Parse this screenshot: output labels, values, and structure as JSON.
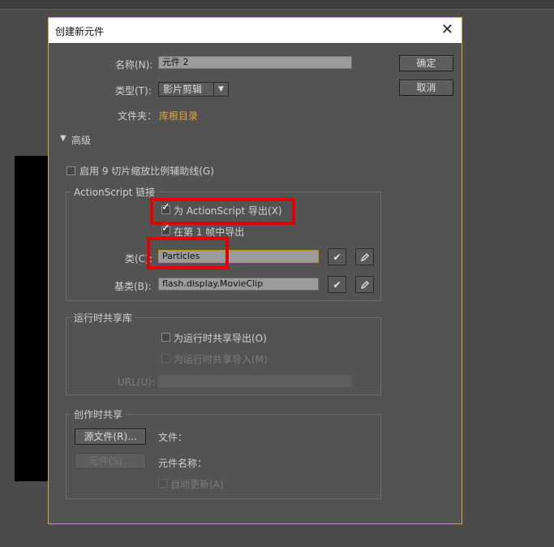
{
  "dialog": {
    "title": "创建新元件",
    "name_label": "名称(N):",
    "name_value": "元件 2",
    "type_label": "类型(T):",
    "type_value": "影片剪辑",
    "folder_label": "文件夹：",
    "folder_value": "库根目录",
    "ok_label": "确定",
    "cancel_label": "取消",
    "advanced_label": "高级",
    "nine_slice_label": "启用 9 切片缩放比例辅助线(G)"
  },
  "actionscript": {
    "group_title": "ActionScript 链接",
    "export_label": "为 ActionScript 导出(X)",
    "export_checked": true,
    "frame1_label": "在第 1 帧中导出",
    "frame1_checked": true,
    "class_label": "类(C):",
    "class_value": "Particles",
    "base_label": "基类(B):",
    "base_value": "flash.display.MovieClip"
  },
  "runtime": {
    "group_title": "运行时共享库",
    "export_label": "为运行时共享导出(O)",
    "import_label": "为运行时共享导入(M)",
    "url_label": "URL(U):",
    "url_value": ""
  },
  "authoring": {
    "group_title": "创作时共享",
    "source_button": "源文件(R)...",
    "symbol_button": "元件(S)...",
    "file_label": "文件：",
    "symbol_name_label": "元件名称：",
    "auto_update_label": "自动更新(A)"
  },
  "colors": {
    "accent_border": "#e0a240",
    "highlight_red": "#e30000",
    "link": "#e6a33c"
  }
}
